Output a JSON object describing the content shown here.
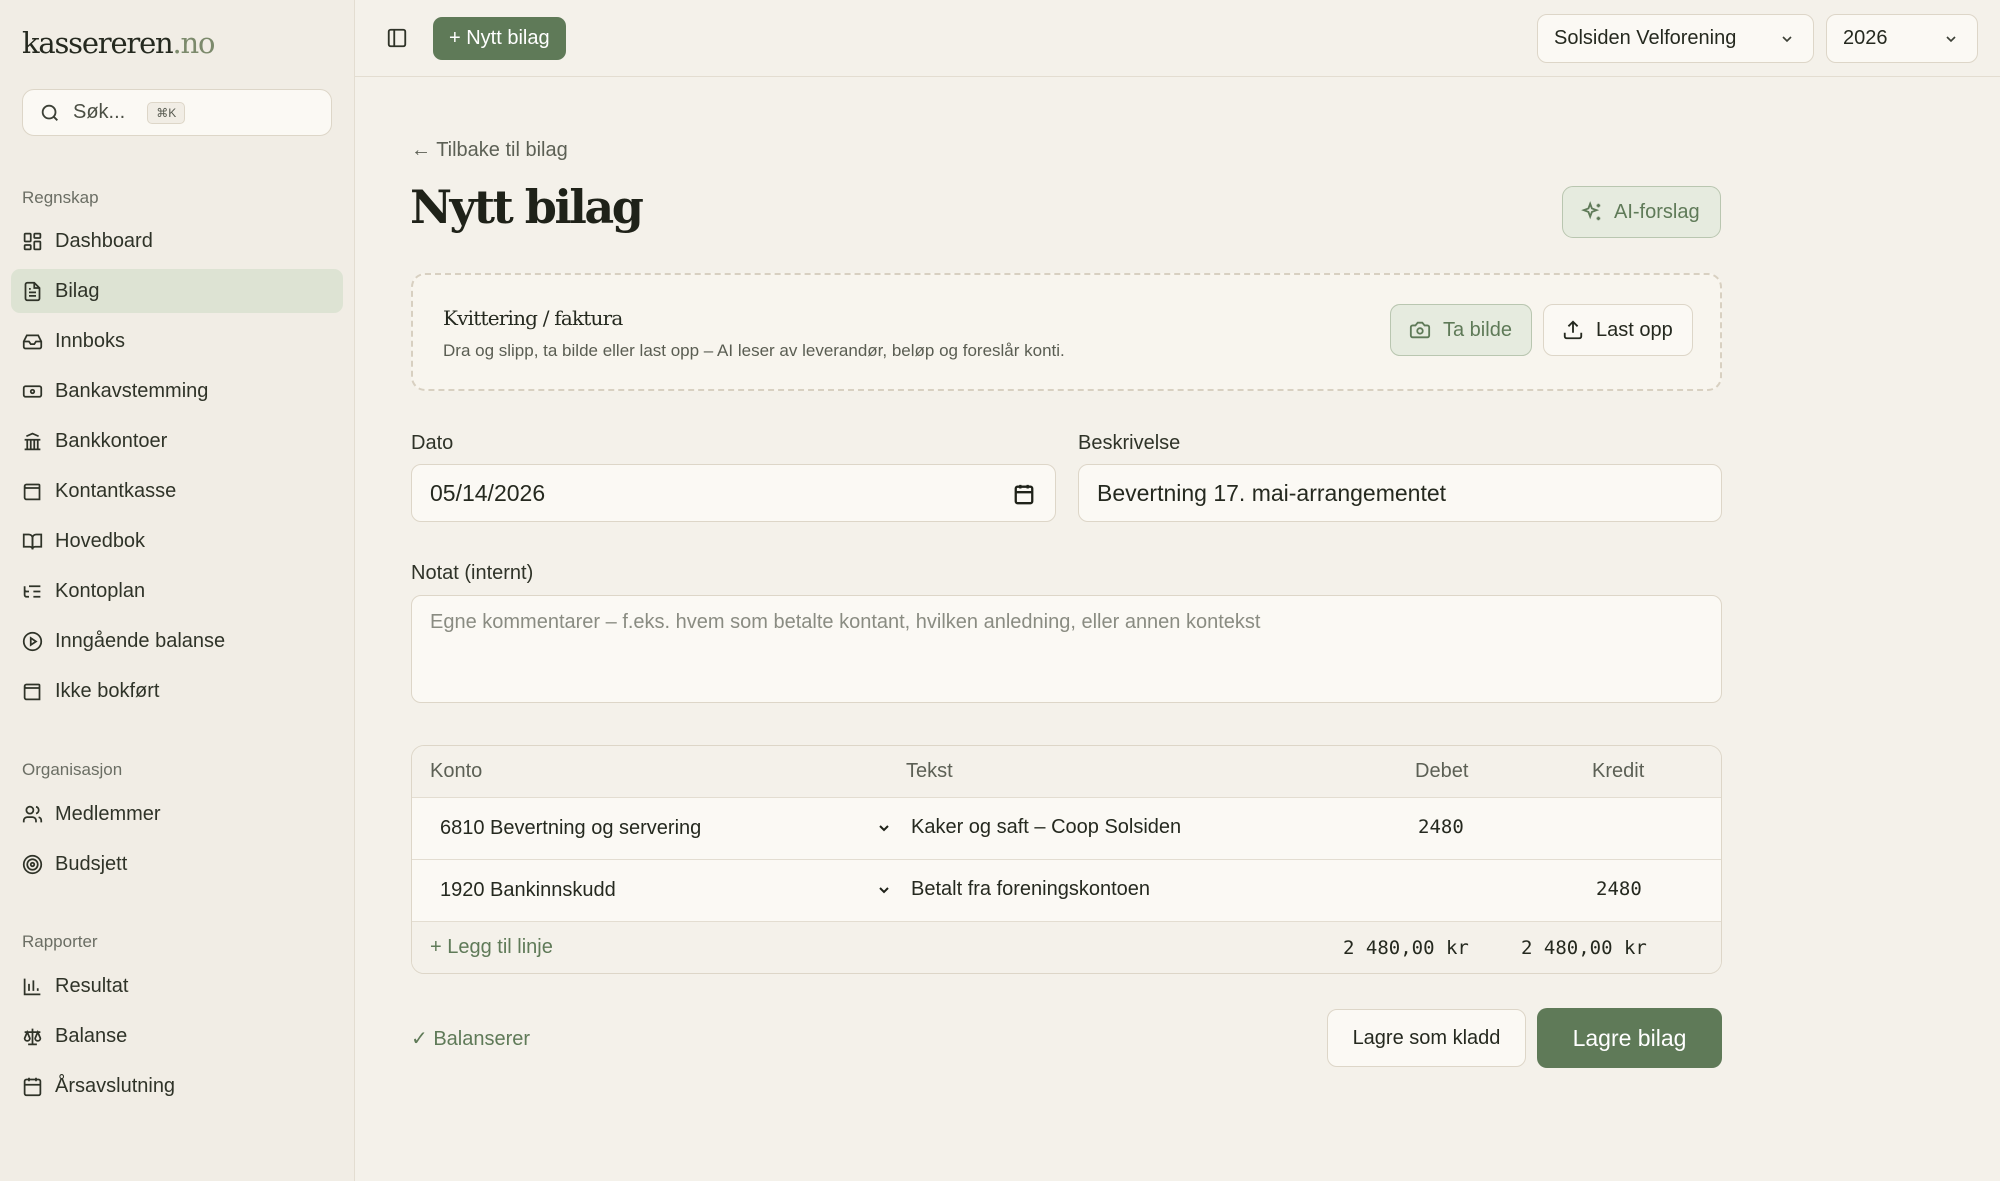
{
  "brand": {
    "name": "kassereren",
    "tld": ".no"
  },
  "search": {
    "placeholder": "Søk...",
    "shortcut": "⌘K"
  },
  "sidebar": {
    "sections": [
      {
        "title": "Regnskap",
        "items": [
          {
            "label": "Dashboard",
            "icon": "dashboard-icon",
            "active": false
          },
          {
            "label": "Bilag",
            "icon": "document-icon",
            "active": true
          },
          {
            "label": "Innboks",
            "icon": "inbox-icon",
            "active": false
          },
          {
            "label": "Bankavstemming",
            "icon": "banknote-icon",
            "active": false
          },
          {
            "label": "Bankkontoer",
            "icon": "bank-icon",
            "active": false
          },
          {
            "label": "Kontantkasse",
            "icon": "wallet-icon",
            "active": false
          },
          {
            "label": "Hovedbok",
            "icon": "book-icon",
            "active": false
          },
          {
            "label": "Kontoplan",
            "icon": "list-tree-icon",
            "active": false
          },
          {
            "label": "Inngående balanse",
            "icon": "play-circle-icon",
            "active": false
          },
          {
            "label": "Ikke bokført",
            "icon": "wallet-alert-icon",
            "active": false
          }
        ]
      },
      {
        "title": "Organisasjon",
        "items": [
          {
            "label": "Medlemmer",
            "icon": "users-icon",
            "active": false
          },
          {
            "label": "Budsjett",
            "icon": "target-icon",
            "active": false
          }
        ]
      },
      {
        "title": "Rapporter",
        "items": [
          {
            "label": "Resultat",
            "icon": "bar-chart-icon",
            "active": false
          },
          {
            "label": "Balanse",
            "icon": "scale-icon",
            "active": false
          },
          {
            "label": "Årsavslutning",
            "icon": "calendar-icon",
            "active": false
          }
        ]
      }
    ]
  },
  "topbar": {
    "new_button": "+ Nytt bilag",
    "organization": "Solsiden Velforening",
    "year": "2026"
  },
  "page": {
    "back_link": "← Tilbake til bilag",
    "title": "Nytt bilag",
    "ai_button": "AI-forslag"
  },
  "dropzone": {
    "title": "Kvittering / faktura",
    "subtitle": "Dra og slipp, ta bilde eller last opp – AI leser av leverandør, beløp og foreslår konti.",
    "camera_button": "Ta bilde",
    "upload_button": "Last opp"
  },
  "form": {
    "date_label": "Dato",
    "date_value": "05/14/2026",
    "description_label": "Beskrivelse",
    "description_value": "Bevertning 17. mai-arrangementet",
    "note_label": "Notat (internt)",
    "note_placeholder": "Egne kommentarer – f.eks. hvem som betalte kontant, hvilken anledning, eller annen kontekst"
  },
  "table": {
    "headers": {
      "account": "Konto",
      "text": "Tekst",
      "debit": "Debet",
      "credit": "Kredit"
    },
    "rows": [
      {
        "account": "6810 Bevertning og servering",
        "text": "Kaker og saft – Coop Solsiden",
        "debit": "2480",
        "credit": ""
      },
      {
        "account": "1920 Bankinnskudd",
        "text": "Betalt fra foreningskontoen",
        "debit": "",
        "credit": "2480"
      }
    ],
    "add_line": "+ Legg til linje",
    "total_debit": "2 480,00 kr",
    "total_credit": "2 480,00 kr"
  },
  "footer": {
    "status": "✓ Balanserer",
    "draft_button": "Lagre som kladd",
    "save_button": "Lagre bilag"
  },
  "colors": {
    "accent": "#5f7a58",
    "background": "#f4f1ea",
    "sidebar": "#f1ede5",
    "active_nav": "#dde3d3"
  }
}
